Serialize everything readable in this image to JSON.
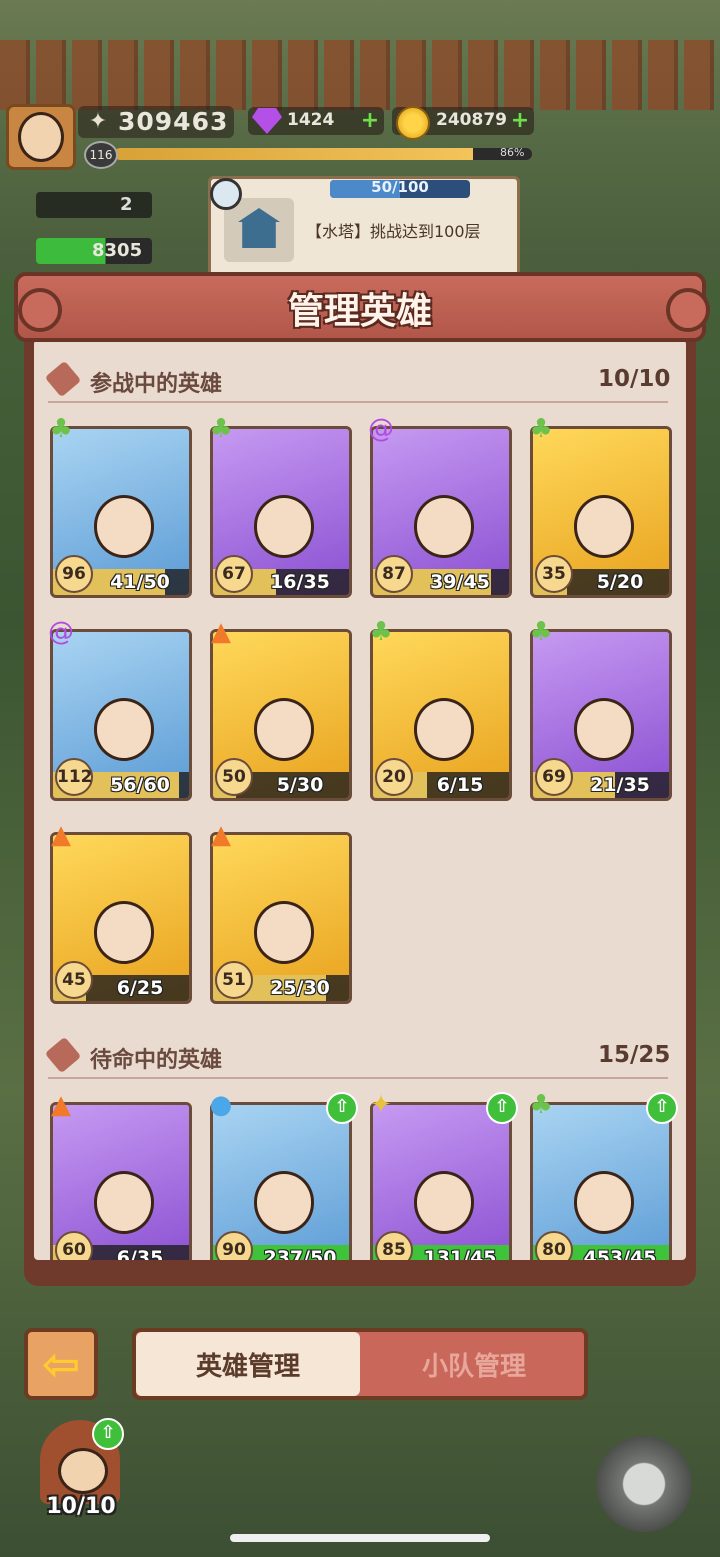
{
  "hud": {
    "power": "309463",
    "gems": "1424",
    "coins": "240879",
    "player_level": "116",
    "xp_percent": "86%",
    "xp_fraction": 0.86,
    "stat_a": "2",
    "stat_b": "8305",
    "plus": "+"
  },
  "quest": {
    "progress": "50/100",
    "progress_fraction": 0.5,
    "text": "【水塔】挑战达到100层"
  },
  "panel": {
    "title": "管理英雄",
    "active_section": {
      "title": "参战中的英雄",
      "count": "10/10"
    },
    "standby_section": {
      "title": "待命中的英雄",
      "count": "15/25"
    }
  },
  "active_heroes": [
    {
      "level": "96",
      "fragments": "41/50",
      "fill": 0.82,
      "element": "grass-icon",
      "colors": [
        "#a9d4f2",
        "#5b9bd5"
      ],
      "upgrade": false
    },
    {
      "level": "67",
      "fragments": "16/35",
      "fill": 0.46,
      "element": "grass-icon",
      "colors": [
        "#c69af2",
        "#8a4fd1"
      ],
      "upgrade": false
    },
    {
      "level": "87",
      "fragments": "39/45",
      "fill": 0.87,
      "element": "vortex-icon",
      "colors": [
        "#c69af2",
        "#8a4fd1"
      ],
      "upgrade": false
    },
    {
      "level": "35",
      "fragments": "5/20",
      "fill": 0.25,
      "element": "grass-icon",
      "colors": [
        "#ffd85a",
        "#e8a21f"
      ],
      "upgrade": false
    },
    {
      "level": "112",
      "fragments": "56/60",
      "fill": 0.93,
      "element": "vortex-icon",
      "colors": [
        "#a9d4f2",
        "#5b9bd5"
      ],
      "upgrade": false
    },
    {
      "level": "50",
      "fragments": "5/30",
      "fill": 0.17,
      "element": "fire-icon",
      "colors": [
        "#ffd85a",
        "#e8a21f"
      ],
      "upgrade": false
    },
    {
      "level": "20",
      "fragments": "6/15",
      "fill": 0.4,
      "element": "grass-icon",
      "colors": [
        "#ffd85a",
        "#e8a21f"
      ],
      "upgrade": false
    },
    {
      "level": "69",
      "fragments": "21/35",
      "fill": 0.6,
      "element": "grass-icon",
      "colors": [
        "#c69af2",
        "#8a4fd1"
      ],
      "upgrade": false
    },
    {
      "level": "45",
      "fragments": "6/25",
      "fill": 0.24,
      "element": "fire-icon",
      "colors": [
        "#ffd85a",
        "#e8a21f"
      ],
      "upgrade": false
    },
    {
      "level": "51",
      "fragments": "25/30",
      "fill": 0.83,
      "element": "fire-icon",
      "colors": [
        "#ffd85a",
        "#e8a21f"
      ],
      "upgrade": false
    }
  ],
  "standby_heroes": [
    {
      "level": "60",
      "fragments": "6/35",
      "fill": 0.17,
      "element": "fire-icon",
      "colors": [
        "#c69af2",
        "#8a4fd1"
      ],
      "upgrade": false
    },
    {
      "level": "90",
      "fragments": "237/50",
      "fill": 1.0,
      "element": "water-icon",
      "colors": [
        "#a9d4f2",
        "#5b9bd5"
      ],
      "upgrade": true
    },
    {
      "level": "85",
      "fragments": "131/45",
      "fill": 1.0,
      "element": "light-icon",
      "colors": [
        "#c69af2",
        "#8a4fd1"
      ],
      "upgrade": true
    },
    {
      "level": "80",
      "fragments": "453/45",
      "fill": 1.0,
      "element": "grass-icon",
      "colors": [
        "#a9d4f2",
        "#5b9bd5"
      ],
      "upgrade": true
    }
  ],
  "nav": {
    "back_icon": "arrow-left-icon",
    "tab_heroes": "英雄管理",
    "tab_squad": "小队管理"
  },
  "bottom": {
    "hero_count": "10/10"
  },
  "element_glyphs": {
    "grass-icon": {
      "glyph": "♣",
      "color": "#6cc24a"
    },
    "vortex-icon": {
      "glyph": "@",
      "color": "#b14be0"
    },
    "fire-icon": {
      "glyph": "▲",
      "color": "#f07a2a"
    },
    "water-icon": {
      "glyph": "●",
      "color": "#4aa8e8"
    },
    "light-icon": {
      "glyph": "✦",
      "color": "#e8c23a"
    }
  }
}
